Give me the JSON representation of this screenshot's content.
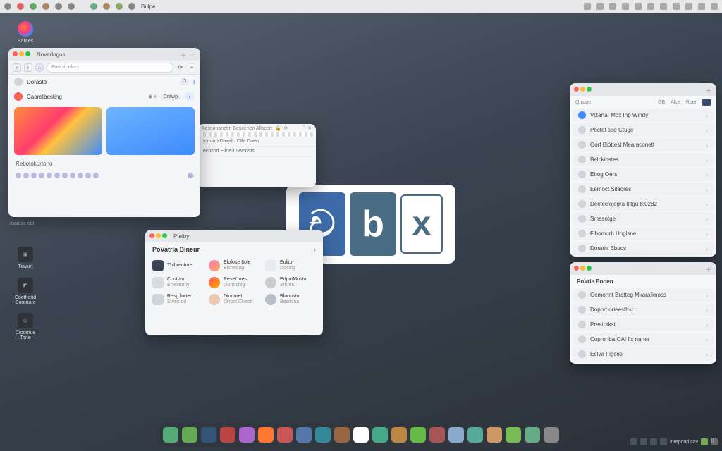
{
  "menubar": {
    "app": "Bulpe",
    "right_icons": 11
  },
  "desktop": {
    "top": "Boraes",
    "icons": [
      {
        "label": "Tiayurt"
      },
      {
        "label": "Coothend Coronare"
      },
      {
        "label": "Croomue Tone"
      }
    ],
    "footer": "Inatose cot"
  },
  "browser": {
    "title": "Noverlogos",
    "addr_placeholder": "Freastpelors",
    "row1": {
      "label": "Dorasto"
    },
    "row2": {
      "label": "CaoreIbesting",
      "pill": "Crewp"
    },
    "caption": "Rebotokortono"
  },
  "codewin": {
    "top": "Aessonanetin Bescenen Allscert",
    "lines": [
      "tomoro   Daxal · CIla Doen",
      "ecosod   Ellne-I Swonsts"
    ]
  },
  "people": {
    "win_title": "Ptelby",
    "header": "PoVatrla Bineur",
    "cells": [
      {
        "name": "Thibrentore",
        "sub": ""
      },
      {
        "name": "Elofose Itole",
        "sub": "Bicrtecag"
      },
      {
        "name": "Eolitor",
        "sub": "Dosoig"
      },
      {
        "name": "Coutvm",
        "sub": "Errectoniy"
      },
      {
        "name": "Reset'mes",
        "sub": "Oorotchig"
      },
      {
        "name": "ErlpotMosto",
        "sub": "Sthnnu"
      },
      {
        "name": "Resg forten",
        "sub": "Stvectod"
      },
      {
        "name": "Dionoret",
        "sub": "Drrost Cbeoh"
      },
      {
        "name": "Bloonstn",
        "sub": "Besrtlina"
      }
    ]
  },
  "logo": {
    "a": "ච",
    "b": "b",
    "c": "x"
  },
  "panel1": {
    "header": {
      "col0": "Qhsser",
      "col1": "GB",
      "col2": "Alce",
      "col3": "Roer"
    },
    "rows": [
      "Vizarta: Mox Inp Wihdy",
      "Poctet sae Ctuge",
      "Oorf Bióttest Mearaconett",
      "Belckiostes",
      "Ehog Oers",
      "Eemoct Silaores",
      "Dectee'ojegra ltitgu 8:0282",
      "Smasotge",
      "Fibomurh Unglsne",
      "Doraria Ebuos"
    ]
  },
  "panel2": {
    "header": "PoVrie Eooen",
    "rows": [
      "Gemonnt Bratteg Mkaraiknoss",
      "Doport orieesfhst",
      "Prestprkst",
      "Copronba OA! fix narter",
      "Eelva Figcos"
    ]
  },
  "dock_count": 21,
  "tray": {
    "items": 4,
    "text": "intepond cav"
  }
}
